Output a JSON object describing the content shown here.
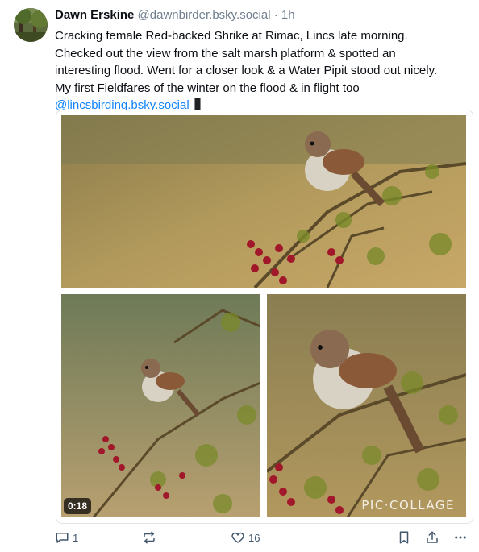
{
  "post": {
    "author_name": "Dawn Erskine",
    "author_handle": "@dawnbirder.bsky.social",
    "timestamp": "· 1h",
    "text_lines": [
      "Cracking female Red-backed Shrike at Rimac, Lincs late morning.",
      "Checked out the view from the salt marsh platform & spotted an",
      "interesting flood. Went for a closer look & a Water Pipit stood out nicely.",
      "My first Fieldfares of the winter on the flood & in flight too"
    ],
    "mention": "@lincsbirding.bsky.social",
    "media": {
      "video_duration": "0:18",
      "watermark": "PIC·COLLAGE"
    },
    "actions": {
      "reply_count": "1",
      "repost_count": "",
      "like_count": "16"
    }
  },
  "colors": {
    "link": "#1083fe",
    "muted": "#6f7f8f",
    "action_icon": "#42576c"
  },
  "icons": {
    "reply": "reply-icon",
    "repost": "repost-icon",
    "like": "heart-icon",
    "bookmark": "bookmark-icon",
    "share": "share-icon",
    "more": "more-icon"
  }
}
